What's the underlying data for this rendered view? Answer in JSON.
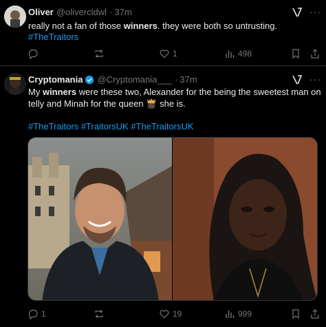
{
  "tweet1": {
    "name": "Oliver",
    "handle": "@olivercldwl",
    "dot": "·",
    "time": "37m",
    "text_parts": [
      "really not a fan of those ",
      "winners",
      ". they were both so untrusting."
    ],
    "hashtag": "#TheTraitors",
    "replies": "",
    "retweets": "",
    "likes": "1",
    "views": "498"
  },
  "tweet2": {
    "name": "Cryptomania",
    "handle": "@Cryptomania___",
    "dot": "·",
    "time": "37m",
    "line1_parts": [
      "My ",
      "winners",
      " were these two, Alexander for the being the sweetest man on"
    ],
    "line2": "telly and Minah for the queen",
    "line2_end": "she is.",
    "emoji": "👸🏿",
    "hashtags": "#TheTraitors #TraitorsUK #TheTraitorsUK",
    "replies": "1",
    "retweets": "",
    "likes": "19",
    "views": "999"
  },
  "colors": {
    "accent": "#1d9bf0",
    "muted": "#71767b",
    "text": "#e7e9ea",
    "border": "#2f3336"
  },
  "icons": [
    "grok-icon",
    "more-icon",
    "reply-icon",
    "retweet-icon",
    "like-icon",
    "views-icon",
    "bookmark-icon",
    "share-icon",
    "verified-icon"
  ]
}
